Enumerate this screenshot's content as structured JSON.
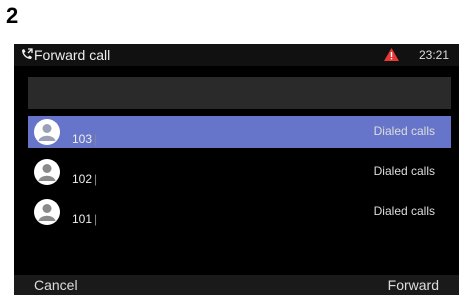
{
  "step_number": "2",
  "titlebar": {
    "title": "Forward call",
    "title_icon": "phone-forward-icon",
    "warning_icon": "warning-icon",
    "time": "23:21",
    "warning_color": "#e53935"
  },
  "search": {
    "value": "",
    "placeholder": ""
  },
  "calls": [
    {
      "number": "103",
      "type": "Dialed calls",
      "selected": true
    },
    {
      "number": "102",
      "type": "Dialed calls",
      "selected": false
    },
    {
      "number": "101",
      "type": "Dialed calls",
      "selected": false
    }
  ],
  "softkeys": {
    "left": "Cancel",
    "right": "Forward"
  },
  "colors": {
    "selection": "#6675c9",
    "background": "#000000"
  }
}
